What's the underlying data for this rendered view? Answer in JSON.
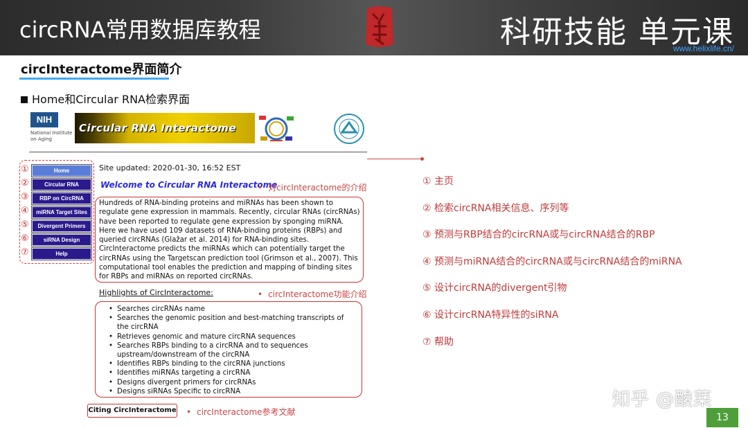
{
  "header": {
    "course_title": "circRNA常用数据库教程",
    "brand": "科研技能 单元课",
    "url": "www.helixlife.cn/"
  },
  "section_title": "circInteractome界面简介",
  "sub_heading": "Home和Circular RNA检索界面",
  "logos": {
    "nih_box": "NIH",
    "nih_sub": "National Institute on Aging",
    "banner_text": "Circular RNA Interactome"
  },
  "nav": [
    {
      "num": "①",
      "label": "Home"
    },
    {
      "num": "②",
      "label": "Circular RNA"
    },
    {
      "num": "③",
      "label": "RBP on CircRNA"
    },
    {
      "num": "④",
      "label": "miRNA Target Sites"
    },
    {
      "num": "⑤",
      "label": "Divergent Primers"
    },
    {
      "num": "⑥",
      "label": "siRNA Design"
    },
    {
      "num": "⑦",
      "label": "Help"
    }
  ],
  "site_updated": "Site updated: 2020-01-30, 16:52 EST",
  "welcome": "Welcome to Circular RNA Interactome",
  "intro_text": "Hundreds of RNA-binding proteins and miRNAs has been shown to regulate gene expression in mammals. Recently, circular RNAs (circRNAs) have been reported to regulate gene expression by sponging miRNA. Here we have used 109 datasets of RNA-binding proteins (RBPs) and queried circRNAs (Glažar et al. 2014) for RNA-binding sites. CircInteractome predicts the miRNAs which can potentially target the circRNAs using the Targetscan prediction tool (Grimson et al., 2007). This computational tool enables the prediction and mapping of binding sites for RBPs and miRNAs on reported circRNAs.",
  "highlights_title": "Highlights of CircInteractome:",
  "highlights": [
    "Searches circRNAs name",
    "Searches the genomic position and best-matching transcripts of the circRNA",
    "Retrieves genomic and mature circRNA sequences",
    "Searches RBPs binding to a circRNA and to sequences upstream/downstream of the circRNA",
    "Identifies RBPs binding to the circRNA junctions",
    "Identifies miRNAs targeting a circRNA",
    "Designs divergent primers for circRNAs",
    "Designs siRNAs Specific to circRNA"
  ],
  "citing": "Citing CircInteractome",
  "annotations": {
    "intro": "对circInteractome的介绍",
    "function": "circInteractome功能介绍",
    "citing": "circInteractome参考文献"
  },
  "right_list": [
    "① 主页",
    "② 检索circRNA相关信息、序列等",
    "③ 预测与RBP结合的circRNA或与circRNA结合的RBP",
    "④ 预测与miRNA结合的circRNA或与circRNA结合的miRNA",
    "⑤ 设计circRNA的divergent引物",
    "⑥ 设计circRNA特异性的siRNA",
    "⑦ 帮助"
  ],
  "watermark": "知乎 @酸菜",
  "page_number": "13",
  "colors": {
    "accent_red": "#c44444",
    "nav_button": "#2b1a8c",
    "home_button": "#5a7ed8",
    "underline_blue": "#3fa9f5",
    "page_badge": "#4e9e3a"
  }
}
